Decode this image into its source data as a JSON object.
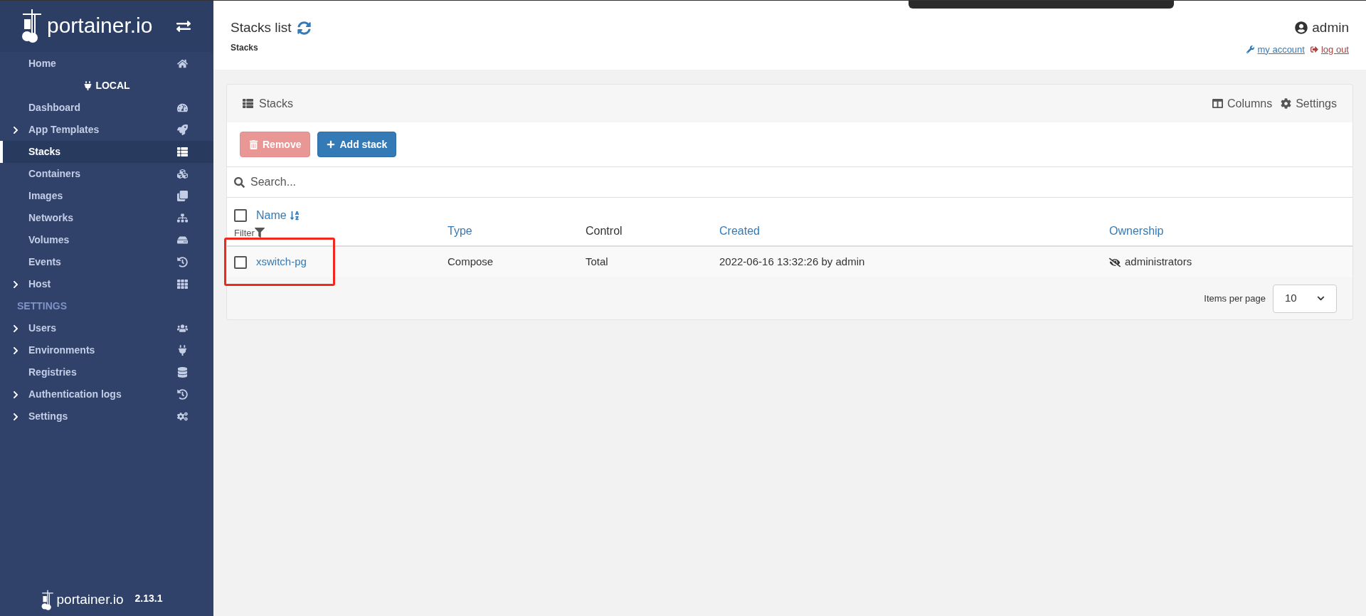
{
  "sidebar": {
    "logo": "portainer.io",
    "items": [
      {
        "kind": "item",
        "label": "Home",
        "expandable": false,
        "selected": false
      },
      {
        "kind": "endpoint",
        "label": "LOCAL"
      },
      {
        "kind": "item",
        "label": "Dashboard",
        "expandable": false,
        "selected": false
      },
      {
        "kind": "item",
        "label": "App Templates",
        "expandable": true,
        "selected": false
      },
      {
        "kind": "item",
        "label": "Stacks",
        "expandable": false,
        "selected": true
      },
      {
        "kind": "item",
        "label": "Containers",
        "expandable": false,
        "selected": false
      },
      {
        "kind": "item",
        "label": "Images",
        "expandable": false,
        "selected": false
      },
      {
        "kind": "item",
        "label": "Networks",
        "expandable": false,
        "selected": false
      },
      {
        "kind": "item",
        "label": "Volumes",
        "expandable": false,
        "selected": false
      },
      {
        "kind": "item",
        "label": "Events",
        "expandable": false,
        "selected": false
      },
      {
        "kind": "item",
        "label": "Host",
        "expandable": true,
        "selected": false
      },
      {
        "kind": "section",
        "label": "SETTINGS"
      },
      {
        "kind": "item",
        "label": "Users",
        "expandable": true,
        "selected": false
      },
      {
        "kind": "item",
        "label": "Environments",
        "expandable": true,
        "selected": false
      },
      {
        "kind": "item",
        "label": "Registries",
        "expandable": false,
        "selected": false
      },
      {
        "kind": "item",
        "label": "Authentication logs",
        "expandable": true,
        "selected": false
      },
      {
        "kind": "item",
        "label": "Settings",
        "expandable": true,
        "selected": false
      }
    ],
    "footer": {
      "logo": "portainer.io",
      "version": "2.13.1"
    }
  },
  "header": {
    "title": "Stacks list",
    "breadcrumb": "Stacks",
    "user": "admin",
    "links": [
      "my account",
      "log out"
    ]
  },
  "panel": {
    "title": "Stacks",
    "tools": [
      "Columns",
      "Settings"
    ],
    "actions": [
      {
        "label": "Remove",
        "disabled": true
      },
      {
        "label": "Add stack",
        "disabled": false
      }
    ],
    "search": {
      "placeholder": "Search..."
    },
    "filter_label": "Filter",
    "select_all_checked": false,
    "columns": [
      {
        "label": "Name",
        "sortable": true
      },
      {
        "label": "Type",
        "sortable": true
      },
      {
        "label": "Control",
        "sortable": false
      },
      {
        "label": "Created",
        "sortable": true
      },
      {
        "label": "Ownership",
        "sortable": true
      }
    ],
    "rows": [
      {
        "checked": false,
        "highlighted": true,
        "name": "xswitch-pg",
        "type": "Compose",
        "control": "Total",
        "created": "2022-06-16 13:32:26 by admin",
        "ownership": "administrators"
      }
    ],
    "pagination": {
      "label": "Items per page",
      "value": "10"
    }
  }
}
